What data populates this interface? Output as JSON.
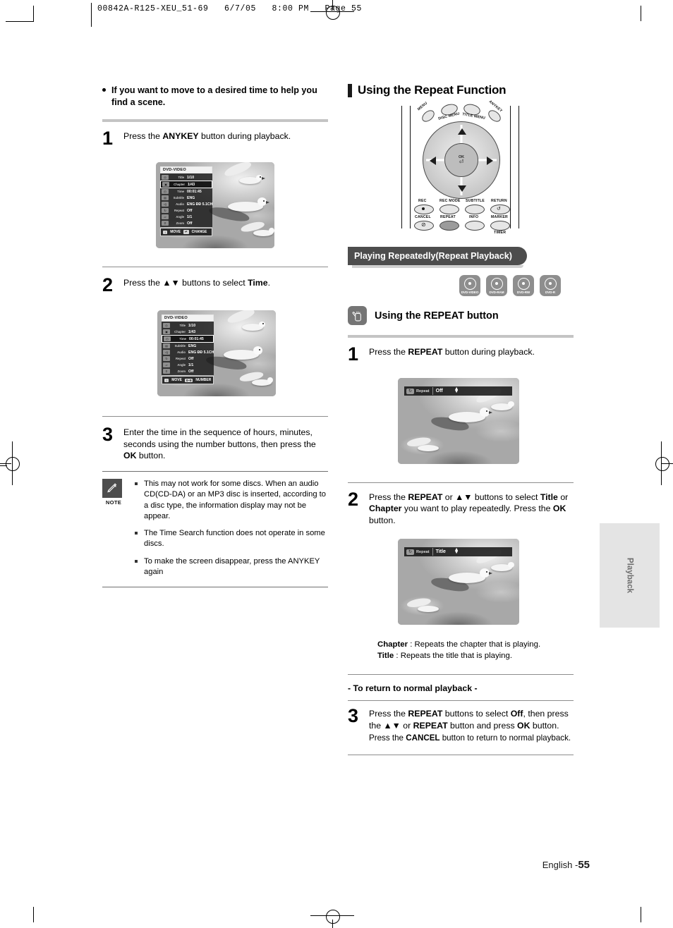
{
  "header": {
    "print_meta": "00842A-R125-XEU_51-69   6/7/05   8:00 PM   Page 55"
  },
  "left_column": {
    "bullet_heading": "If you want to move to a desired time to help you find a scene.",
    "steps": [
      {
        "num": "1",
        "text_html": "Press the <b>ANYKEY</b> button during playback."
      },
      {
        "num": "2",
        "text_html": "Press the ▲▼ buttons to select <b>Time</b>."
      },
      {
        "num": "3",
        "text_html": "Enter the time in the sequence of hours, minutes, seconds using the number buttons, then press the <b>OK</b> button."
      }
    ],
    "osd_screen_1": {
      "title": "DVD-VIDEO",
      "selected_row": "Chapter",
      "rows": [
        {
          "label": "Title",
          "value": "1/10",
          "icon": "disc-icon"
        },
        {
          "label": "Chapter",
          "value": "1/43",
          "icon": "chapter-icon"
        },
        {
          "label": "Time",
          "value": "00:01:45",
          "icon": "clock-icon"
        },
        {
          "label": "Subtitle",
          "value": "ENG",
          "icon": "subtitle-icon"
        },
        {
          "label": "Audio",
          "value": "ENG  ĐĐ 5.1CH",
          "icon": "speaker-icon"
        },
        {
          "label": "Repeat",
          "value": "Off",
          "icon": "repeat-icon"
        },
        {
          "label": "Angle",
          "value": "1/1",
          "icon": "angle-icon"
        },
        {
          "label": "Zoom",
          "value": "Off",
          "icon": "zoom-icon"
        }
      ],
      "footer_keys": [
        {
          "key": "↕",
          "label": "MOVE"
        },
        {
          "key": "↵",
          "label": "CHANGE"
        }
      ]
    },
    "osd_screen_2": {
      "title": "DVD-VIDEO",
      "selected_row": "Time",
      "rows": [
        {
          "label": "Title",
          "value": "1/10",
          "icon": "disc-icon"
        },
        {
          "label": "Chapter",
          "value": "1/43",
          "icon": "chapter-icon"
        },
        {
          "label": "Time",
          "value": "00:01:45",
          "icon": "clock-icon"
        },
        {
          "label": "Subtitle",
          "value": "ENG",
          "icon": "subtitle-icon"
        },
        {
          "label": "Audio",
          "value": "ENG  ĐĐ 5.1CH",
          "icon": "speaker-icon"
        },
        {
          "label": "Repeat",
          "value": "Off",
          "icon": "repeat-icon"
        },
        {
          "label": "Angle",
          "value": "1/1",
          "icon": "angle-icon"
        },
        {
          "label": "Zoom",
          "value": "Off",
          "icon": "zoom-icon"
        }
      ],
      "footer_keys": [
        {
          "key": "↕",
          "label": "MOVE"
        },
        {
          "key": "0~9",
          "label": "NUMBER"
        }
      ]
    },
    "note": {
      "label": "NOTE",
      "items": [
        "This may not work for some discs. When an audio CD(CD-DA) or an MP3 disc is inserted, according to a disc type, the information display may not be appear.",
        "The Time Search function does not operate in some discs.",
        "To make the screen disappear, press the ANYKEY again"
      ]
    }
  },
  "right_column": {
    "section_title": "Using the Repeat Function",
    "remote": {
      "top_labels": [
        "MENU",
        "DISC MENU",
        "TITLE MENU",
        "ANYKEY"
      ],
      "dpad_center": "OK",
      "row1": [
        "REC",
        "REC MODE",
        "SUBTITLE",
        "RETURN"
      ],
      "row2": [
        "CANCEL",
        "REPEAT",
        "INFO",
        "MARKER"
      ],
      "row2_sub": "TIMER",
      "highlighted_button": "REPEAT"
    },
    "capsule_title": "Playing Repeatedly(Repeat Playback)",
    "disc_badges": [
      "DVD-VIDEO",
      "DVD-RAM",
      "DVD-RW",
      "DVD-R"
    ],
    "subhead": "Using the REPEAT button",
    "steps": [
      {
        "num": "1",
        "text_html": "Press the <b>REPEAT</b> button during playback."
      },
      {
        "num": "2",
        "text_html": "Press the <b>REPEAT</b> or ▲▼ buttons to select <b>Title</b> or <b>Chapter</b> you want to play repeatedly. Press the <b>OK</b> button."
      },
      {
        "num": "3",
        "text_html": "Press the <b>REPEAT</b> buttons to select <b>Off</b>, then press the ▲▼ or <b>REPEAT</b> button and press <b>OK</b> button.",
        "sub_html": "Press the <b>CANCEL</b> button to return to normal playback."
      }
    ],
    "repeat_osd_1": {
      "icon": "repeat-icon",
      "label": "Repeat",
      "value": "Off",
      "arrows": "↕"
    },
    "repeat_osd_2": {
      "icon": "repeat-icon",
      "label": "Repeat",
      "value": "Title",
      "arrows": "↕"
    },
    "descriptions": [
      {
        "term": "Chapter",
        "text": " : Repeats the chapter that is playing."
      },
      {
        "term": "Title",
        "text": " : Repeats the title that is playing."
      }
    ],
    "return_heading": "- To return to normal playback -"
  },
  "side_tab": "Playback",
  "footer": {
    "lang": "English -",
    "page": "55"
  },
  "colors": {
    "accent_gray": "#4d4d4d",
    "rule": "#c4c4c4",
    "tab_bg": "#e4e4e4"
  }
}
